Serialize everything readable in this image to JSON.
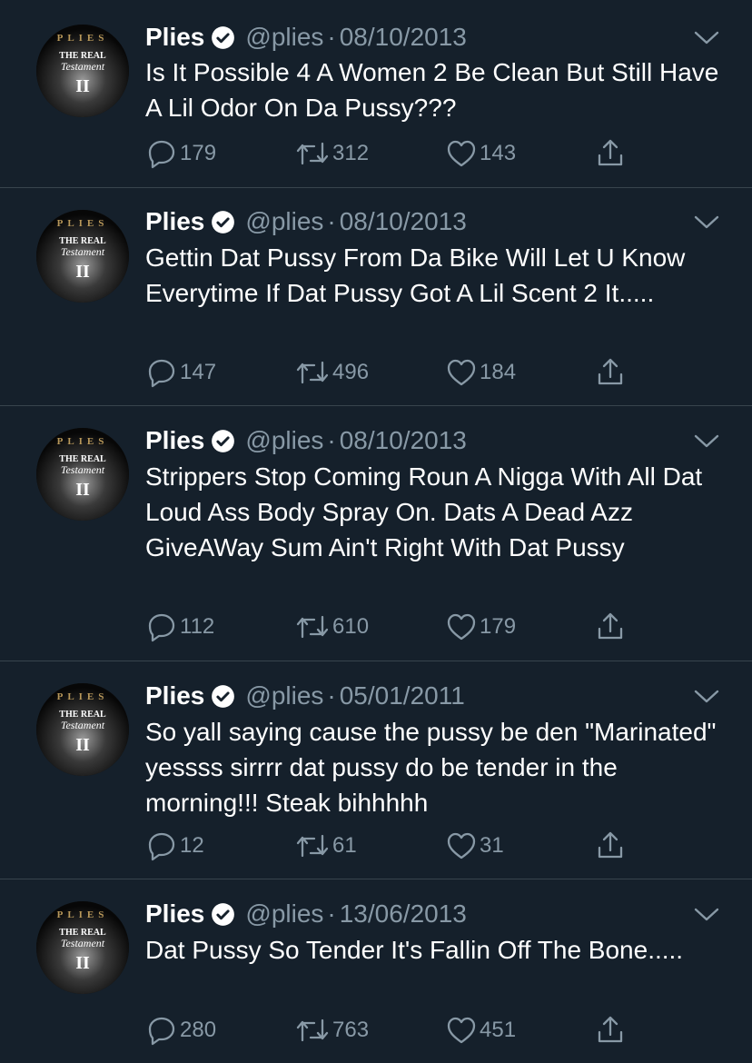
{
  "colors": {
    "background": "#15202b",
    "text": "#ffffff",
    "secondary": "#8899a6",
    "divider": "#38444d"
  },
  "avatar": {
    "top_text": "PLIES",
    "line1": "THE REAL",
    "line2": "Testament",
    "line3": "II"
  },
  "tweets": [
    {
      "name": "Plies",
      "handle": "@plies",
      "separator": "·",
      "date": "08/10/2013",
      "text": "Is It Possible 4 A Women 2 Be Clean But Still Have A Lil Odor On Da Pussy???",
      "replies": "179",
      "retweets": "312",
      "likes": "143"
    },
    {
      "name": "Plies",
      "handle": "@plies",
      "separator": "·",
      "date": "08/10/2013",
      "text": "Gettin Dat Pussy From Da Bike Will Let U Know Everytime If Dat Pussy Got A Lil Scent 2 It.....",
      "replies": "147",
      "retweets": "496",
      "likes": "184"
    },
    {
      "name": "Plies",
      "handle": "@plies",
      "separator": "·",
      "date": "08/10/2013",
      "text": "Strippers Stop Coming Roun A Nigga With All Dat Loud Ass Body Spray On. Dats A Dead Azz GiveAWay Sum Ain't Right With Dat Pussy",
      "replies": "112",
      "retweets": "610",
      "likes": "179"
    },
    {
      "name": "Plies",
      "handle": "@plies",
      "separator": "·",
      "date": "05/01/2011",
      "text": "So yall saying cause the pussy be den \"Marinated\" yessss sirrrr dat pussy do be tender in the morning!!! Steak bihhhhh",
      "replies": "12",
      "retweets": "61",
      "likes": "31"
    },
    {
      "name": "Plies",
      "handle": "@plies",
      "separator": "·",
      "date": "13/06/2013",
      "text": "Dat Pussy So Tender It's Fallin Off The Bone.....",
      "replies": "280",
      "retweets": "763",
      "likes": "451"
    }
  ],
  "icons": {
    "verified": "verified-badge-icon",
    "chevron": "chevron-down-icon",
    "reply": "reply-icon",
    "retweet": "retweet-icon",
    "like": "heart-icon",
    "share": "share-icon"
  }
}
